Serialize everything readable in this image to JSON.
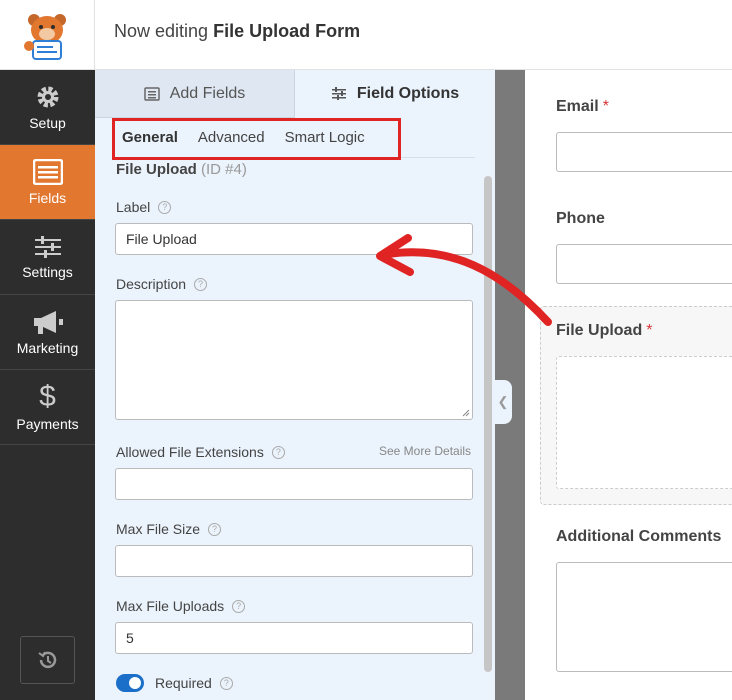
{
  "header": {
    "prefix": "Now editing",
    "form_name": "File Upload Form"
  },
  "nav": [
    {
      "label": "Setup",
      "icon": "gear-icon"
    },
    {
      "label": "Fields",
      "icon": "list-icon",
      "active": true
    },
    {
      "label": "Settings",
      "icon": "sliders-icon"
    },
    {
      "label": "Marketing",
      "icon": "megaphone-icon"
    },
    {
      "label": "Payments",
      "icon": "dollar-icon"
    }
  ],
  "panel": {
    "tabs": {
      "add_fields": "Add Fields",
      "field_options": "Field Options"
    },
    "subtabs": {
      "general": "General",
      "advanced": "Advanced",
      "smart_logic": "Smart Logic"
    },
    "field_title": "File Upload",
    "field_id": "(ID #4)",
    "label_label": "Label",
    "label_value": "File Upload",
    "description_label": "Description",
    "extensions_label": "Allowed File Extensions",
    "see_more": "See More Details",
    "max_size_label": "Max File Size",
    "max_uploads_label": "Max File Uploads",
    "max_uploads_value": "5",
    "required_label": "Required"
  },
  "preview": {
    "email_label": "Email",
    "phone_label": "Phone",
    "upload_label": "File Upload",
    "comments_label": "Additional Comments",
    "required_mark": "*"
  },
  "colors": {
    "accent": "#e27730",
    "highlight": "#e02424",
    "toggle": "#1b6fc8"
  }
}
